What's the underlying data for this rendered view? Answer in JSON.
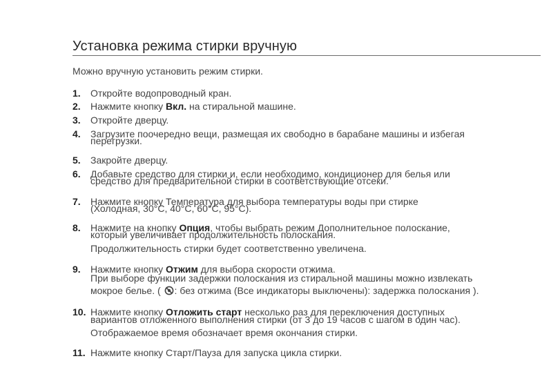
{
  "title": "Установка режима стирки вручную",
  "intro": "Можно вручную установить режим стирки.",
  "steps": [
    {
      "num": "1.",
      "lines": [
        [
          "Откройте водопроводный кран."
        ]
      ]
    },
    {
      "num": "2.",
      "lines": [
        [
          "Нажмите кнопку ",
          "Вкл.",
          " на стиральной машине."
        ]
      ]
    },
    {
      "num": "3.",
      "lines": [
        [
          "Откройте дверцу."
        ]
      ]
    },
    {
      "num": "4.",
      "lines": [
        [
          "Загрузите поочередно вещи, размещая их свободно в барабане машины и избегая"
        ],
        [
          "перегрузки."
        ]
      ]
    },
    {
      "num": "5.",
      "lines": [
        [
          "Закройте дверцу."
        ]
      ]
    },
    {
      "num": "6.",
      "lines": [
        [
          "Добавьте средство для стирки и, если необходимо, кондиционер для белья или"
        ],
        [
          "средство для предварительной стирки в соответствующие отсеки."
        ]
      ]
    },
    {
      "num": "7.",
      "lines": [
        [
          "Нажмите кнопку Температура для выбора температуры воды при стирке"
        ],
        [
          "(Холодная, 30°C, 40°C, 60°C, 95°C)."
        ]
      ]
    },
    {
      "num": "8.",
      "lines": [
        [
          "Нажмите на кнопку ",
          "Опция",
          ", чтобы выбрать режим Дополнительное полоскание,"
        ],
        [
          "который увеличивает продолжительность полоскания."
        ],
        [
          "Продолжительность стирки будет соответственно увеличена."
        ]
      ]
    },
    {
      "num": "9.",
      "lines": [
        [
          "Нажмите кнопку ",
          "Отжим",
          " для выбора скорости отжима."
        ],
        [
          "При выборе функции задержки полоскания из стиральной машины можно извлекать"
        ],
        [
          "мокрое белье. ( ",
          ": без отжима (Все индикаторы выключены): задержка полоскания )."
        ]
      ]
    },
    {
      "num": "10.",
      "lines": [
        [
          "Нажмите кнопку ",
          "Отложить старт",
          " несколько раз для переключения доступных"
        ],
        [
          "вариантов отложенного выполнения стирки (от 3 до 19 часов с шагом в один час)."
        ],
        [
          "Отображаемое время обозначает время окончания стирки."
        ]
      ]
    },
    {
      "num": "11.",
      "lines": [
        [
          "Нажмите кнопку Старт/Пауза для запуска цикла стирки."
        ]
      ]
    }
  ]
}
